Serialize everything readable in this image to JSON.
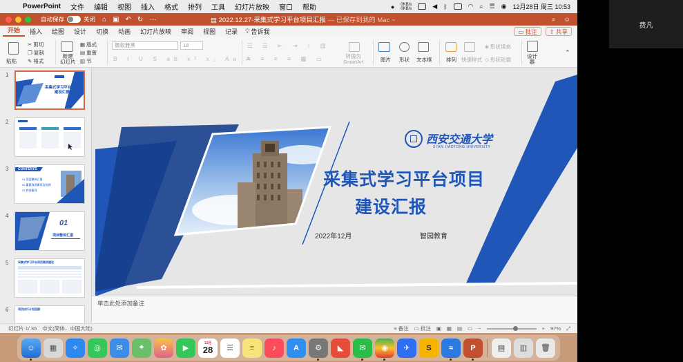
{
  "menubar": {
    "app": "PowerPoint",
    "items": [
      "文件",
      "编辑",
      "视图",
      "插入",
      "格式",
      "排列",
      "工具",
      "幻灯片放映",
      "窗口",
      "帮助"
    ],
    "status_top": "0KB/s",
    "status_bottom": "0KB/s",
    "clock": "12月28日 周三  10:53"
  },
  "titlebar": {
    "autosave_label": "自动保存",
    "autosave_state": "关闭",
    "doc_title": "2022.12.27-采集式学习平台项目汇报",
    "saved_status": " — 已保存到我的 Mac ~"
  },
  "ribbon_tabs": {
    "items": [
      "开始",
      "插入",
      "绘图",
      "设计",
      "切换",
      "动画",
      "幻灯片放映",
      "审阅",
      "视图",
      "记录"
    ],
    "active": "开始",
    "tell_me": "告诉我",
    "comments": "批注",
    "share": "共享"
  },
  "ribbon": {
    "paste": "粘贴",
    "cut": "剪切",
    "copy": "复制",
    "format": "格式",
    "new_slide": "新建\n幻灯片",
    "layout": "版式",
    "reset": "重置",
    "section": "节",
    "font_name": "微软雅黑",
    "font_size": "18",
    "convert_smartart": "转换为\nSmartArt",
    "picture": "图片",
    "shape": "形状",
    "textbox": "文本框",
    "arrange": "排列",
    "quick_styles": "快速样式",
    "shape_fill": "形状填充",
    "shape_outline": "形状轮廓",
    "designer": "设计\n器"
  },
  "slides": {
    "numbers": [
      "1",
      "2",
      "3",
      "4",
      "5",
      "6"
    ],
    "t1_title": "采集式学习平台项目\n建设汇报",
    "t3_contents": "CONTENTS",
    "t3_items": [
      "01 项目整体汇报",
      "02 重要改进事项及处理",
      "03 其他事项"
    ],
    "t4_num": "01",
    "t4_title": "项目整体汇报",
    "t5_title": "采集式学习平台项目需求建设",
    "t6_title": "项目执行计划回顾"
  },
  "slide": {
    "title_line1": "采集式学习平台项目",
    "title_line2": "建设汇报",
    "date": "2022年12月",
    "org": "智园教育",
    "logo_cn": "西安交通大学",
    "logo_en": "XI'AN JIAOTONG UNIVERSITY"
  },
  "notes_placeholder": "单击此处添加备注",
  "statusbar": {
    "slide_pos": "幻灯片 1/ 36",
    "language": "中文(简体，中国大陆)",
    "notes": "备注",
    "comments": "批注",
    "zoom": "97%"
  },
  "dock": {
    "calendar_month": "12月",
    "calendar_day": "28"
  },
  "participant_name": "费凡",
  "colors": {
    "accent": "#c1502e",
    "slide_blue": "#1f56b8",
    "slide_blue_dark": "#163f8c"
  }
}
